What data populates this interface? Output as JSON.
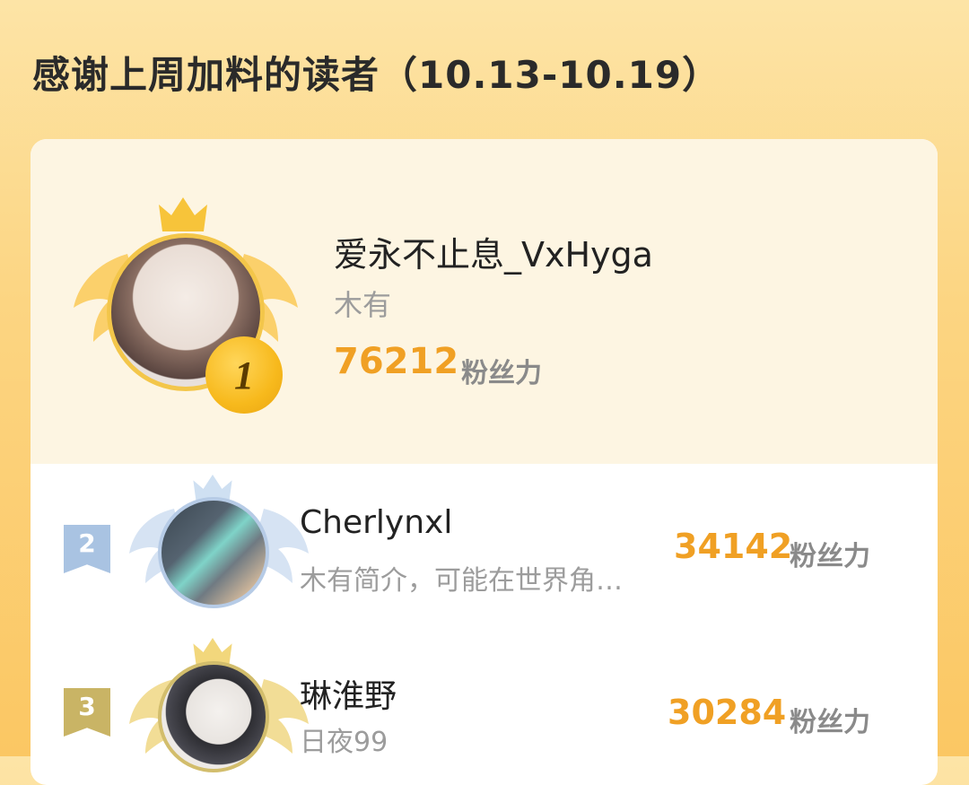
{
  "header": {
    "title": "感谢上周加料的读者（10.13-10.19）"
  },
  "top_reader": {
    "rank": "1",
    "name": "爱永不止息_VxHyga",
    "bio": "木有",
    "score": "76212",
    "score_unit": "粉丝力"
  },
  "readers": [
    {
      "rank": "2",
      "name": "Cherlynxl",
      "bio": "木有简介，可能在世界角…",
      "score": "34142",
      "score_unit": "粉丝力",
      "rank_color": "#a9c3e2"
    },
    {
      "rank": "3",
      "name": "琳淮野",
      "bio": "日夜99",
      "score": "30284",
      "score_unit": "粉丝力",
      "rank_color": "#c9b465"
    }
  ],
  "colors": {
    "accent": "#f0a024",
    "gold": "#f7b91c",
    "silver": "#a9c3e2",
    "bronze": "#c9b465"
  }
}
